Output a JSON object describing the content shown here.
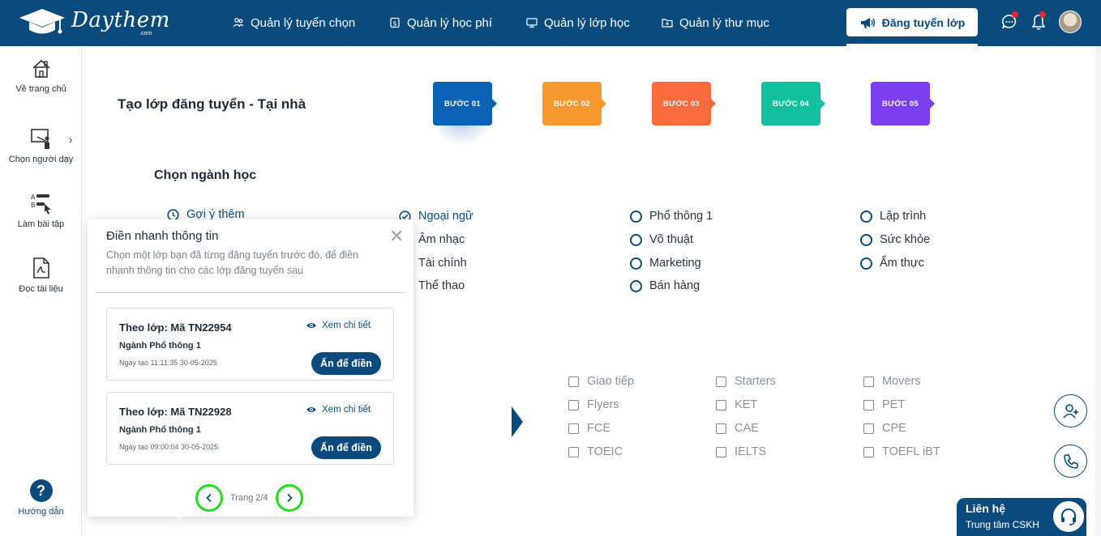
{
  "header": {
    "logo_text": "Daythem",
    "logo_sub": ".com",
    "nav": [
      {
        "label": "Quản lý tuyển chọn",
        "icon": "people-icon"
      },
      {
        "label": "Quản lý học phí",
        "icon": "money-icon"
      },
      {
        "label": "Quản lý lớp học",
        "icon": "monitor-icon"
      },
      {
        "label": "Quản lý thư mục",
        "icon": "folder-icon"
      }
    ],
    "post_button": "Đăng tuyển lớp",
    "colors": {
      "primary": "#0b4a7d",
      "notification_dot": "#e8262b"
    }
  },
  "sidebar": {
    "items": [
      {
        "label": "Về trang chủ",
        "icon": "home-icon"
      },
      {
        "label": "Chọn người dạy",
        "icon": "teacher-board-icon"
      },
      {
        "label": "Làm bài tập",
        "icon": "quiz-list-icon"
      },
      {
        "label": "Đọc tài liệu",
        "icon": "pdf-icon"
      }
    ],
    "help": {
      "label": "Hướng dẫn",
      "icon_text": "?"
    }
  },
  "page": {
    "title": "Tạo lớp đăng tuyển - Tại nhà",
    "steps": [
      {
        "label": "BƯỚC 01",
        "color": "#0b62b5"
      },
      {
        "label": "BƯỚC 02",
        "color": "#f7992f"
      },
      {
        "label": "BƯỚC 03",
        "color": "#fb6a3d"
      },
      {
        "label": "BƯỚC 04",
        "color": "#12c0a0"
      },
      {
        "label": "BƯỚC 05",
        "color": "#7b3ff0"
      }
    ],
    "section_title": "Chọn ngành học",
    "suggest_label": "Gợi ý thêm",
    "majors": [
      {
        "label": "Ngoại ngữ",
        "checked": true
      },
      {
        "label": "Âm nhạc",
        "checked": false
      },
      {
        "label": "Tài chính",
        "checked": false
      },
      {
        "label": "Thể thao",
        "checked": false
      },
      {
        "label": "Phổ thông 1",
        "checked": false
      },
      {
        "label": "Võ thuật",
        "checked": false
      },
      {
        "label": "Marketing",
        "checked": false
      },
      {
        "label": "Bán hàng",
        "checked": false
      },
      {
        "label": "Lập trình",
        "checked": false
      },
      {
        "label": "Sức khỏe",
        "checked": false
      },
      {
        "label": "Ẩm thực",
        "checked": false
      }
    ],
    "subjects": [
      "Giao tiếp",
      "Starters",
      "Movers",
      "Flyers",
      "KET",
      "PET",
      "FCE",
      "CAE",
      "CPE",
      "TOEIC",
      "IELTS",
      "TOEFL iBT"
    ]
  },
  "popup": {
    "title": "Điền nhanh thông tin",
    "close_icon": "close-icon",
    "description": "Chọn một lớp bạn đã từng đăng tuyển trước đó, để điền nhanh thông tin cho các lớp đăng tuyển sau",
    "cards": [
      {
        "title": "Theo lớp: Mã TN22954",
        "major": "Ngành Phổ thông 1",
        "date": "Ngày tạo 11:11:35 30-05-2025",
        "view": "Xem chi tiết",
        "fill": "Ấn để điền"
      },
      {
        "title": "Theo lớp: Mã TN22928",
        "major": "Ngành Phổ thông 1",
        "date": "Ngày tạo 09:00:04 30-05-2025",
        "view": "Xem chi tiết",
        "fill": "Ấn để điền"
      }
    ],
    "pager": "Trang 2/4",
    "pager_highlight_color": "#22dd22"
  },
  "contact": {
    "title": "Liên hệ",
    "subtitle": "Trung tâm CSKH"
  }
}
